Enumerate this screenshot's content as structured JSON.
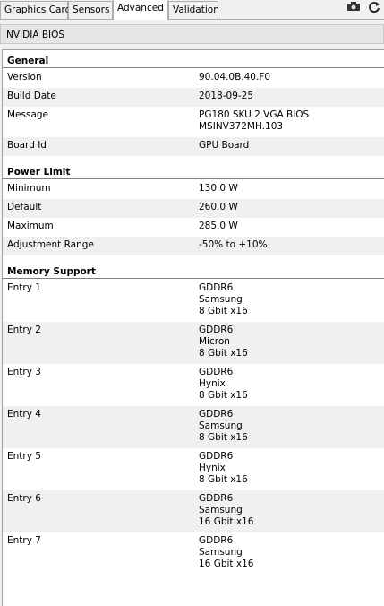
{
  "tabs": [
    "Graphics Card",
    "Sensors",
    "Advanced",
    "Validation"
  ],
  "active_tab": "Advanced",
  "dropdown": {
    "selected": "NVIDIA BIOS"
  },
  "sections": {
    "general": {
      "title": "General",
      "rows": [
        {
          "key": "Version",
          "value": [
            "90.04.0B.40.F0"
          ]
        },
        {
          "key": "Build Date",
          "value": [
            "2018-09-25"
          ]
        },
        {
          "key": "Message",
          "value": [
            "PG180 SKU 2 VGA BIOS",
            "MSINV372MH.103"
          ]
        },
        {
          "key": "Board Id",
          "value": [
            "GPU Board"
          ]
        }
      ]
    },
    "power": {
      "title": "Power Limit",
      "rows": [
        {
          "key": "Minimum",
          "value": [
            "130.0 W"
          ]
        },
        {
          "key": "Default",
          "value": [
            "260.0 W"
          ]
        },
        {
          "key": "Maximum",
          "value": [
            "285.0 W"
          ]
        },
        {
          "key": "Adjustment Range",
          "value": [
            "-50% to +10%"
          ]
        }
      ]
    },
    "memory": {
      "title": "Memory Support",
      "rows": [
        {
          "key": "Entry 1",
          "value": [
            "GDDR6",
            "Samsung",
            "8 Gbit x16"
          ]
        },
        {
          "key": "Entry 2",
          "value": [
            "GDDR6",
            "Micron",
            "8 Gbit x16"
          ]
        },
        {
          "key": "Entry 3",
          "value": [
            "GDDR6",
            "Hynix",
            "8 Gbit x16"
          ]
        },
        {
          "key": "Entry 4",
          "value": [
            "GDDR6",
            "Samsung",
            "8 Gbit x16"
          ]
        },
        {
          "key": "Entry 5",
          "value": [
            "GDDR6",
            "Hynix",
            "8 Gbit x16"
          ]
        },
        {
          "key": "Entry 6",
          "value": [
            "GDDR6",
            "Samsung",
            "16 Gbit x16"
          ]
        },
        {
          "key": "Entry 7",
          "value": [
            "GDDR6",
            "Samsung",
            "16 Gbit x16"
          ]
        }
      ]
    }
  },
  "toolbar_icons": [
    "camera-icon",
    "refresh-icon"
  ]
}
